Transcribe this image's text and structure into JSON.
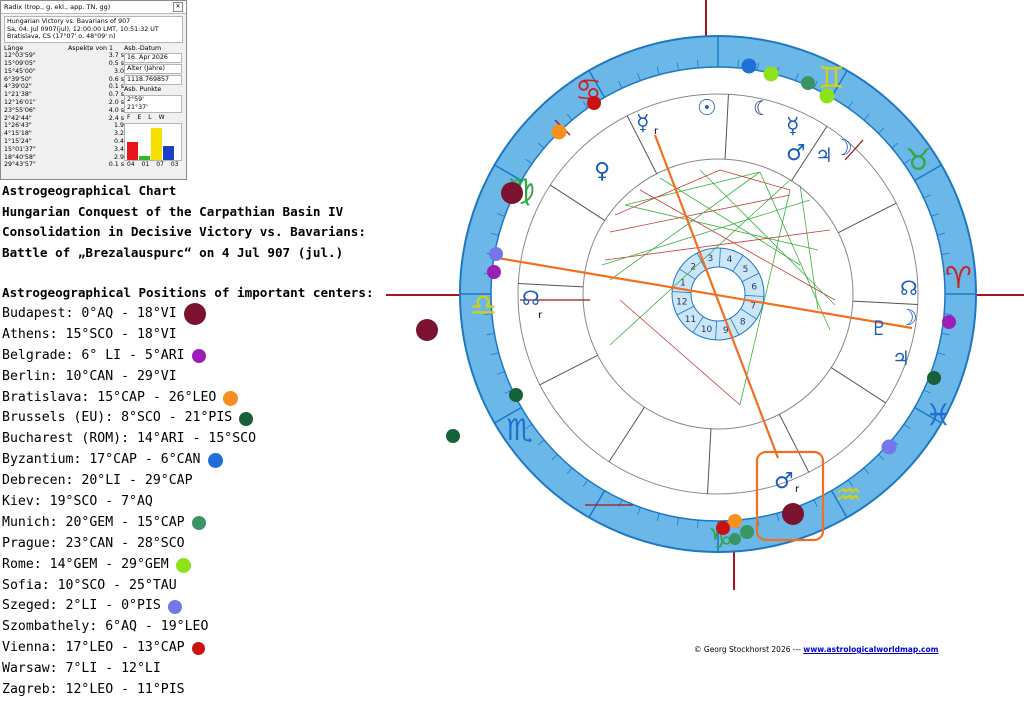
{
  "radix": {
    "window_title": "Radix (trop., g. ekl., app. TN, gg)",
    "header_lines": [
      "Hungarian Victory vs. Bavarians of 907",
      "Sa, 04. Jul 0907(jul), 12:00:00 LMT, 10:51:32 UT",
      "Bratislava, CS (17°07' o, 48°09' n)"
    ],
    "col_length": "Länge",
    "col_aspects": "Aspekte von 1",
    "col_date": "Asb.-Datum",
    "lengths": [
      "12°03'59\"",
      "15°09'05\"",
      "15°45'00\"",
      "6°39'50\"",
      "4°39'02\"",
      "1°21'38\"",
      "12°16'01\"",
      "23°55'06\"",
      "2°42'44\"",
      "1°26'43\"",
      "4°15'18\"",
      "1°15'24\"",
      "15°01'37\"",
      "18°40'58\"",
      "29°43'57\""
    ],
    "aspects": [
      "3.7 s",
      "0.5 s",
      "3.0",
      "0.6 s",
      "0.1 s",
      "0.7 s",
      "2.0 s",
      "4.0 s",
      "2.4 s",
      "1.9",
      "3.2",
      "0.4",
      "3.4",
      "2.9",
      "0.1 s"
    ],
    "date_value": "16. Apr 2026",
    "age_label": "Alter (Jahre)",
    "age_value": "1118.769857",
    "points_label": "Asb. Punkte",
    "points": [
      "2°59'",
      "21°37'"
    ],
    "element_labels": [
      "F",
      "E",
      "L",
      "W"
    ],
    "element_counts": [
      "04",
      "01",
      "07",
      "03"
    ],
    "element_values": [
      4,
      1,
      7,
      3
    ]
  },
  "title_lines": [
    "Astrogeographical Chart",
    "Hungarian Conquest of the Carpathian Basin IV",
    "Consolidation in Decisive Victory vs. Bavarians:",
    "Battle of „Brezalauspurc“ on 4 Jul 907 (jul.)"
  ],
  "positions_heading": "Astrogeographical Positions of important centers:",
  "cities": [
    {
      "text": "Budapest: 0°AQ - 18°VI",
      "color": "#7b1230",
      "size": 22
    },
    {
      "text": "Athens: 15°SCO - 18°VI",
      "color": "",
      "size": 0
    },
    {
      "text": "Belgrade: 6° LI  - 5°ARI",
      "color": "#9b1fb5",
      "size": 14
    },
    {
      "text": "Berlin: 10°CAN - 29°VI",
      "color": "",
      "size": 0
    },
    {
      "text": "Bratislava: 15°CAP - 26°LEO",
      "color": "#f7901e",
      "size": 15
    },
    {
      "text": "Brussels (EU): 8°SCO - 21°PIS",
      "color": "#17603a",
      "size": 14
    },
    {
      "text": "Bucharest (ROM): 14°ARI - 15°SCO",
      "color": "",
      "size": 0
    },
    {
      "text": "Byzantium: 17°CAP - 6°CAN",
      "color": "#1f6fd6",
      "size": 15
    },
    {
      "text": "Debrecen: 20°LI - 29°CAP",
      "color": "",
      "size": 0
    },
    {
      "text": "Kiev: 19°SCO - 7°AQ",
      "color": "",
      "size": 0
    },
    {
      "text": "Munich: 20°GEM - 15°CAP",
      "color": "#3a9463",
      "size": 14
    },
    {
      "text": "Prague: 23°CAN - 28°SCO",
      "color": "",
      "size": 0
    },
    {
      "text": "Rome:  14°GEM - 29°GEM",
      "color": "#8de21c",
      "size": 15
    },
    {
      "text": "Sofia: 10°SCO - 25°TAU",
      "color": "",
      "size": 0
    },
    {
      "text": "Szeged: 2°LI - 0°PIS",
      "color": "#7377ea",
      "size": 14
    },
    {
      "text": "Szombathely: 6°AQ - 19°LEO",
      "color": "",
      "size": 0
    },
    {
      "text": "Vienna:  17°LEO - 13°CAP",
      "color": "#cc1111",
      "size": 13
    },
    {
      "text": "Warsaw: 7°LI - 12°LI",
      "color": "",
      "size": 0
    },
    {
      "text": "Zagreb: 12°LEO - 11°PIS",
      "color": "",
      "size": 0
    }
  ],
  "house_numbers": [
    "1",
    "2",
    "3",
    "4",
    "5",
    "6",
    "7",
    "8",
    "9",
    "10",
    "11",
    "12"
  ],
  "retrograde_mark": "r",
  "credit_prefix": "© Georg Stockhorst 2026 --- ",
  "credit_link": "www.astrologicalworldmap.com",
  "colors": {
    "ring": "#6bb7e8",
    "ring_edge": "#1d78c4",
    "orange": "#f36e1f",
    "axis": "#a3141c"
  }
}
